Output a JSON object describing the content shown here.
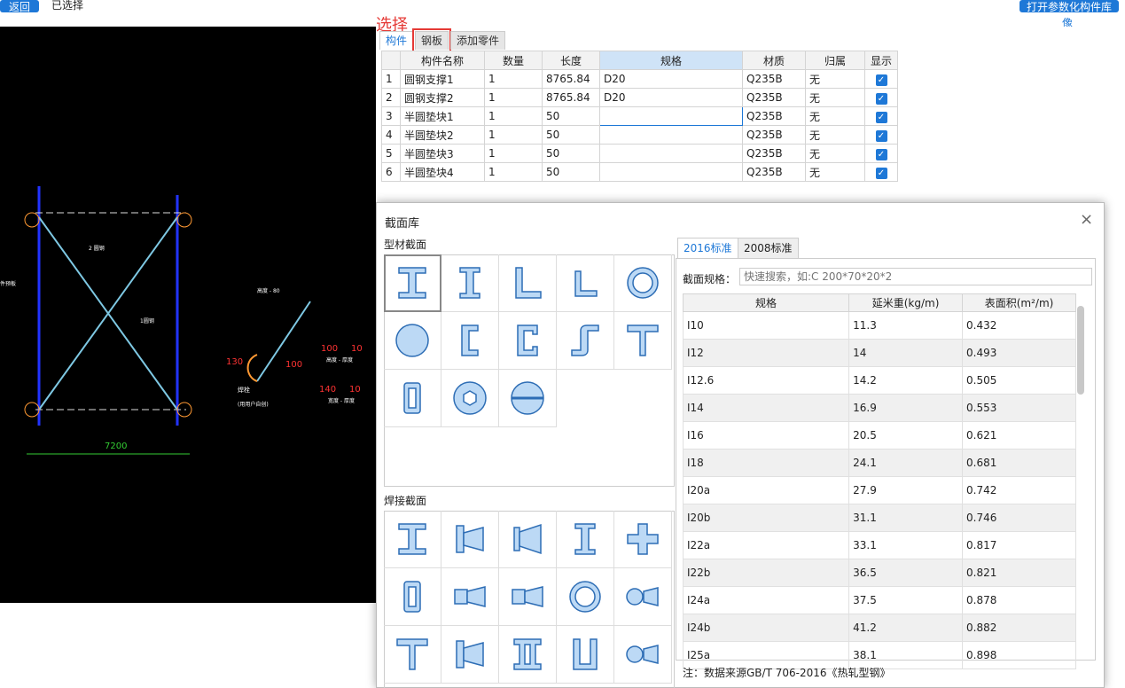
{
  "topbar": {
    "back_label": "返回",
    "selected_label": "已选择",
    "open_lib_label": "打开参数化构件库",
    "open_lib_sub": "像"
  },
  "annotation": {
    "select_label": "选择"
  },
  "tabs": [
    {
      "label": "构件"
    },
    {
      "label": "钢板"
    },
    {
      "label": "添加零件"
    }
  ],
  "grid": {
    "headers": [
      "构件名称",
      "数量",
      "长度",
      "规格",
      "材质",
      "归属",
      "显示"
    ],
    "rows": [
      {
        "n": "1",
        "name": "圆钢支撑1",
        "qty": "1",
        "len": "8765.84",
        "spec": "D20",
        "mat": "Q235B",
        "owner": "无"
      },
      {
        "n": "2",
        "name": "圆钢支撑2",
        "qty": "1",
        "len": "8765.84",
        "spec": "D20",
        "mat": "Q235B",
        "owner": "无"
      },
      {
        "n": "3",
        "name": "半圆垫块1",
        "qty": "1",
        "len": "50",
        "spec": "",
        "mat": "Q235B",
        "owner": "无"
      },
      {
        "n": "4",
        "name": "半圆垫块2",
        "qty": "1",
        "len": "50",
        "spec": "",
        "mat": "Q235B",
        "owner": "无"
      },
      {
        "n": "5",
        "name": "半圆垫块3",
        "qty": "1",
        "len": "50",
        "spec": "",
        "mat": "Q235B",
        "owner": "无"
      },
      {
        "n": "6",
        "name": "半圆垫块4",
        "qty": "1",
        "len": "50",
        "spec": "",
        "mat": "Q235B",
        "owner": "无"
      }
    ]
  },
  "cad": {
    "dim_width": "7200",
    "labels": {
      "round_steel": "2 圆钢",
      "round_steel2": "1圆钢",
      "plate": "件预板",
      "weld": "焊栓",
      "weld_note": "(用用户自创)",
      "d1": "100",
      "d2": "10",
      "d3": "130",
      "d4": "100",
      "d5": "140",
      "d6": "10",
      "n1": "高度 - 厚度",
      "n2": "宽度 - 厚度",
      "top_note": "高度 - 80"
    }
  },
  "dialog": {
    "title": "截面库",
    "section1": "型材截面",
    "section2": "焊接截面",
    "tab_2016": "2016标准",
    "tab_2008": "2008标准",
    "search_label": "截面规格：",
    "search_placeholder": "快速搜索，如:C 200*70*20*2",
    "spec_headers": [
      "规格",
      "延米重(kg/m)",
      "表面积(m²/m)"
    ],
    "spec_rows": [
      [
        "I10",
        "11.3",
        "0.432"
      ],
      [
        "I12",
        "14",
        "0.493"
      ],
      [
        "I12.6",
        "14.2",
        "0.505"
      ],
      [
        "I14",
        "16.9",
        "0.553"
      ],
      [
        "I16",
        "20.5",
        "0.621"
      ],
      [
        "I18",
        "24.1",
        "0.681"
      ],
      [
        "I20a",
        "27.9",
        "0.742"
      ],
      [
        "I20b",
        "31.1",
        "0.746"
      ],
      [
        "I22a",
        "33.1",
        "0.817"
      ],
      [
        "I22b",
        "36.5",
        "0.821"
      ],
      [
        "I24a",
        "37.5",
        "0.878"
      ],
      [
        "I24b",
        "41.2",
        "0.882"
      ],
      [
        "I25a",
        "38.1",
        "0.898"
      ]
    ],
    "note": "注：数据来源GB/T 706-2016《热轧型钢》"
  },
  "colors": {
    "accent": "#1e78d7",
    "highlight": "#e53935",
    "icon_fill": "#bcd9f5",
    "icon_stroke": "#2d6db5"
  }
}
